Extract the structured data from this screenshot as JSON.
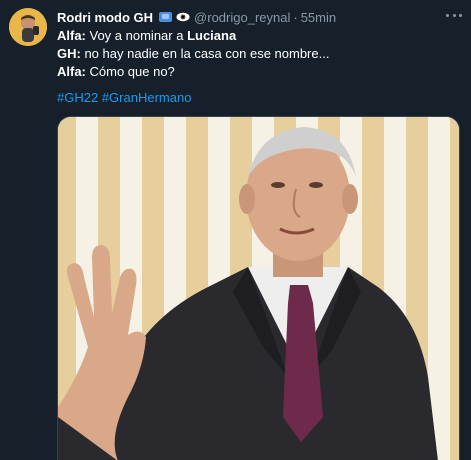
{
  "author": {
    "name": "Rodri modo GH",
    "handle": "@rodrigo_reynal",
    "separator": "·",
    "time": "55min",
    "badges": [
      "tv-icon",
      "eye-icon"
    ]
  },
  "tweet": {
    "lines": [
      {
        "speaker": "Alfa:",
        "before": " Voy a nominar a ",
        "bold_tail": "Luciana"
      },
      {
        "speaker": "GH:",
        "text": " no hay nadie en la casa con ese nombre..."
      },
      {
        "speaker": "Alfa:",
        "text": " Cómo que no?"
      }
    ],
    "hashtags": [
      "#GH22",
      "#GranHermano"
    ]
  },
  "media": {
    "icon": "photo-man-in-suit-raising-hand",
    "colors": {
      "stripe_light": "#f4efe2",
      "stripe_gold": "#e3c98f",
      "suit": "#2a2a2e",
      "tie": "#6e2a4a",
      "skin": "#d9a889"
    }
  },
  "colors": {
    "background": "#15202b",
    "text": "#ffffff",
    "secondary": "#8b98a5",
    "link": "#1d9bf0"
  }
}
